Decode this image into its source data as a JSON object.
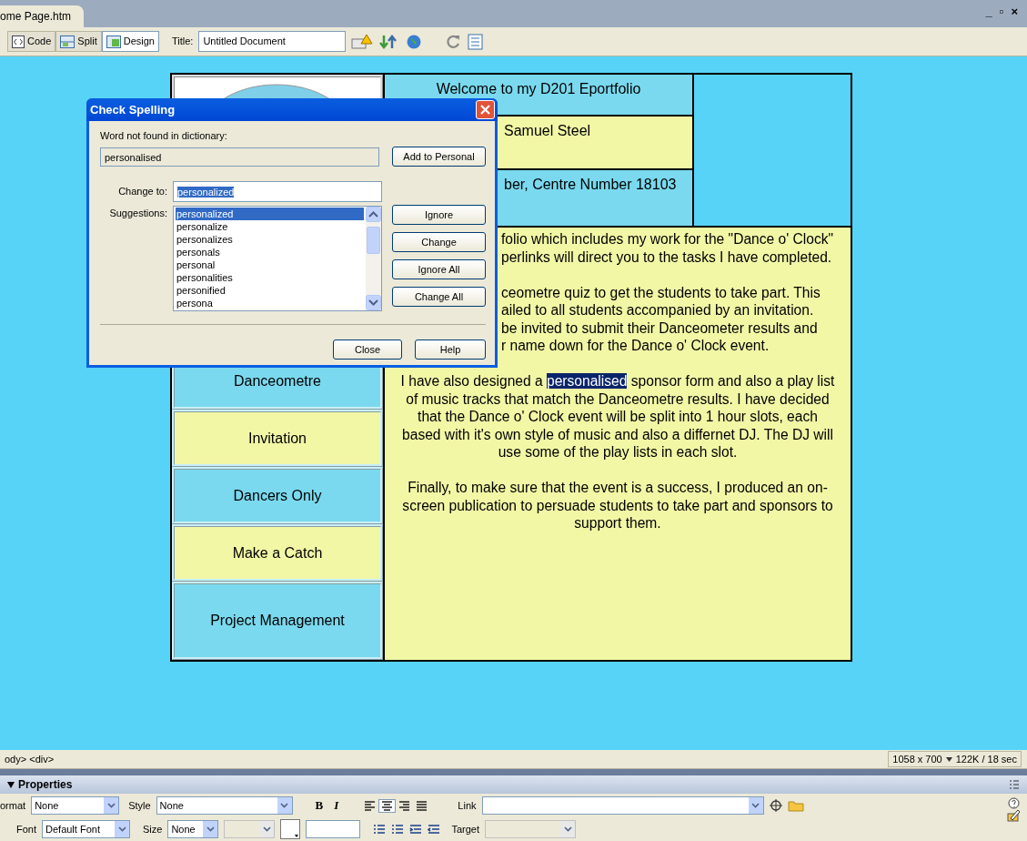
{
  "document_tab": {
    "label": "ome Page.htm"
  },
  "window_controls": [
    "_",
    "▫",
    "×"
  ],
  "toolbar": {
    "views": [
      {
        "label": "Code",
        "selected": false
      },
      {
        "label": "Split",
        "selected": false
      },
      {
        "label": "Design",
        "selected": true
      }
    ],
    "title_label": "Title:",
    "title_value": "Untitled Document"
  },
  "page": {
    "header_cells": [
      {
        "text": "Welcome to my D201 Eportfolio",
        "kind": "blue"
      },
      {
        "text": "Samuel Steel",
        "kind": "yellow"
      },
      {
        "text": "ber, Centre Number 18103",
        "kind": "blue"
      }
    ],
    "nav_links": [
      {
        "label": "Danceometre",
        "kind": "blue"
      },
      {
        "label": "Invitation",
        "kind": "yellow"
      },
      {
        "label": "Dancers Only",
        "kind": "blue"
      },
      {
        "label": "Make a Catch",
        "kind": "yellow"
      },
      {
        "label": "Project Management",
        "kind": "blue"
      }
    ],
    "body_lines": [
      {
        "text": "folio which includes my work for the \"Dance o' Clock\"",
        "kind": "covered"
      },
      {
        "text": "perlinks will direct you to the tasks I have completed.",
        "kind": "covered"
      },
      {
        "kind": "gap"
      },
      {
        "text": "ceometre quiz to get the students to take part. This",
        "kind": "covered"
      },
      {
        "text": "ailed to all students accompanied by an invitation.",
        "kind": "covered"
      },
      {
        "text": "be invited to submit their Danceometer results and",
        "kind": "covered"
      },
      {
        "text": "r name down for the Dance o' Clock event.",
        "kind": "covered"
      },
      {
        "kind": "gap"
      },
      {
        "text": "I have also designed a ",
        "highlighted": "personalised",
        "text_after": " sponsor form and also a play list",
        "kind": "full"
      },
      {
        "text": "of music tracks that match the Danceometre results. I have decided",
        "kind": "full"
      },
      {
        "text": "that the Dance o' Clock event will be split into 1 hour slots, each",
        "kind": "full"
      },
      {
        "text": "based with it's own style of music and also a differnet DJ. The DJ will",
        "kind": "full"
      },
      {
        "text": "use some of the play lists in each slot.",
        "kind": "full"
      },
      {
        "kind": "gap"
      },
      {
        "text": "Finally, to make sure that the event is a success, I produced an on-",
        "kind": "full"
      },
      {
        "text": "screen publication to persuade students to take part and sponsors to",
        "kind": "full"
      },
      {
        "text": "support them.",
        "kind": "full"
      }
    ]
  },
  "dialog": {
    "title": "Check Spelling",
    "not_found_label": "Word not found in dictionary:",
    "not_found_value": "personalised",
    "add_button": "Add to Personal",
    "change_to_label": "Change to:",
    "change_to_value": "personalized",
    "suggestions_label": "Suggestions:",
    "suggestions": [
      {
        "text": "personalized",
        "selected": true
      },
      {
        "text": "personalize",
        "selected": false
      },
      {
        "text": "personalizes",
        "selected": false
      },
      {
        "text": "personals",
        "selected": false
      },
      {
        "text": "personal",
        "selected": false
      },
      {
        "text": "personalities",
        "selected": false
      },
      {
        "text": "personified",
        "selected": false
      },
      {
        "text": "persona",
        "selected": false
      }
    ],
    "side_buttons": [
      "Ignore",
      "Change",
      "Ignore All",
      "Change All"
    ],
    "bottom_buttons": [
      "Close",
      "Help"
    ]
  },
  "status_bar": {
    "tag_path": "ody> <div>",
    "window_size": "1058 x 700",
    "download": "122K / 18 sec"
  },
  "properties": {
    "title": "Properties",
    "format_label": "ormat",
    "format_value": "None",
    "style_label": "Style",
    "style_value": "None",
    "bold": "B",
    "italic": "I",
    "alignments": [
      {
        "kind": "left",
        "selected": false
      },
      {
        "kind": "center",
        "selected": true
      },
      {
        "kind": "right",
        "selected": false
      },
      {
        "kind": "justify",
        "selected": false
      }
    ],
    "link_label": "Link",
    "font_label": "Font",
    "font_value": "Default Font",
    "size_label": "Size",
    "size_value": "None",
    "target_label": "Target"
  }
}
